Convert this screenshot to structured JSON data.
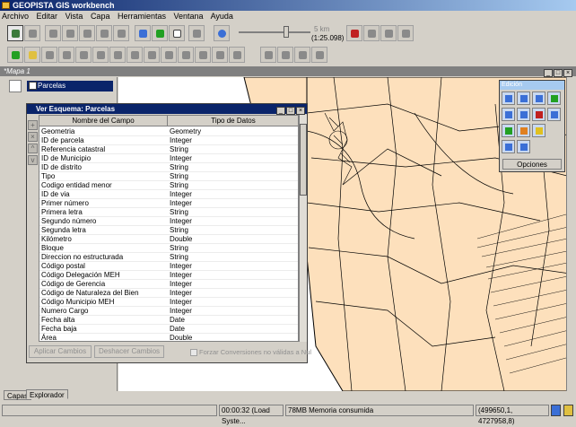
{
  "app": {
    "title": "GEOPISTA GIS workbench"
  },
  "menu": [
    "Archivo",
    "Editar",
    "Vista",
    "Capa",
    "Herramientas",
    "Ventana",
    "Ayuda"
  ],
  "scale": {
    "distance": "5 km",
    "ratio": "(1:25.098)"
  },
  "map_window": {
    "title": "*Mapa 1"
  },
  "layers": {
    "selected": "Parcelas",
    "tabs": [
      "Capas",
      "Explorador"
    ]
  },
  "schema": {
    "title": "Ver Esquema: Parcelas",
    "columns": [
      "Nombre del Campo",
      "Tipo de Datos"
    ],
    "rows": [
      [
        "Geometria",
        "Geometry"
      ],
      [
        "ID de parcela",
        "Integer"
      ],
      [
        "Referencia catastral",
        "String"
      ],
      [
        "ID de Municipio",
        "Integer"
      ],
      [
        "ID de distrito",
        "String"
      ],
      [
        "Tipo",
        "String"
      ],
      [
        "Codigo entidad menor",
        "String"
      ],
      [
        "ID de via",
        "Integer"
      ],
      [
        "Primer número",
        "Integer"
      ],
      [
        "Primera letra",
        "String"
      ],
      [
        "Segundo número",
        "Integer"
      ],
      [
        "Segunda letra",
        "String"
      ],
      [
        "Kilómetro",
        "Double"
      ],
      [
        "Bloque",
        "String"
      ],
      [
        "Direccion no estructurada",
        "String"
      ],
      [
        "Código postal",
        "Integer"
      ],
      [
        "Código Delegación MEH",
        "Integer"
      ],
      [
        "Código de Gerencia",
        "Integer"
      ],
      [
        "Código de Naturaleza del Bien",
        "Integer"
      ],
      [
        "Código Municipio MEH",
        "Integer"
      ],
      [
        "Numero Cargo",
        "Integer"
      ],
      [
        "Fecha alta",
        "Date"
      ],
      [
        "Fecha baja",
        "Date"
      ],
      [
        "Área",
        "Double"
      ]
    ],
    "buttons": {
      "apply": "Aplicar Cambios",
      "undo": "Deshacer Cambios"
    },
    "force_label": "Forzar Conversiones no válidas a Nul"
  },
  "edit_panel": {
    "title": "Edición",
    "options": "Opciones"
  },
  "status": {
    "time": "00:00:32 (Load Syste...",
    "memory": "78MB Memoria consumida",
    "coords": "(499650,1, 4727958,8)"
  },
  "colors": {
    "parcel_fill": "#fde0bc",
    "title_blue": "#0a246a"
  }
}
